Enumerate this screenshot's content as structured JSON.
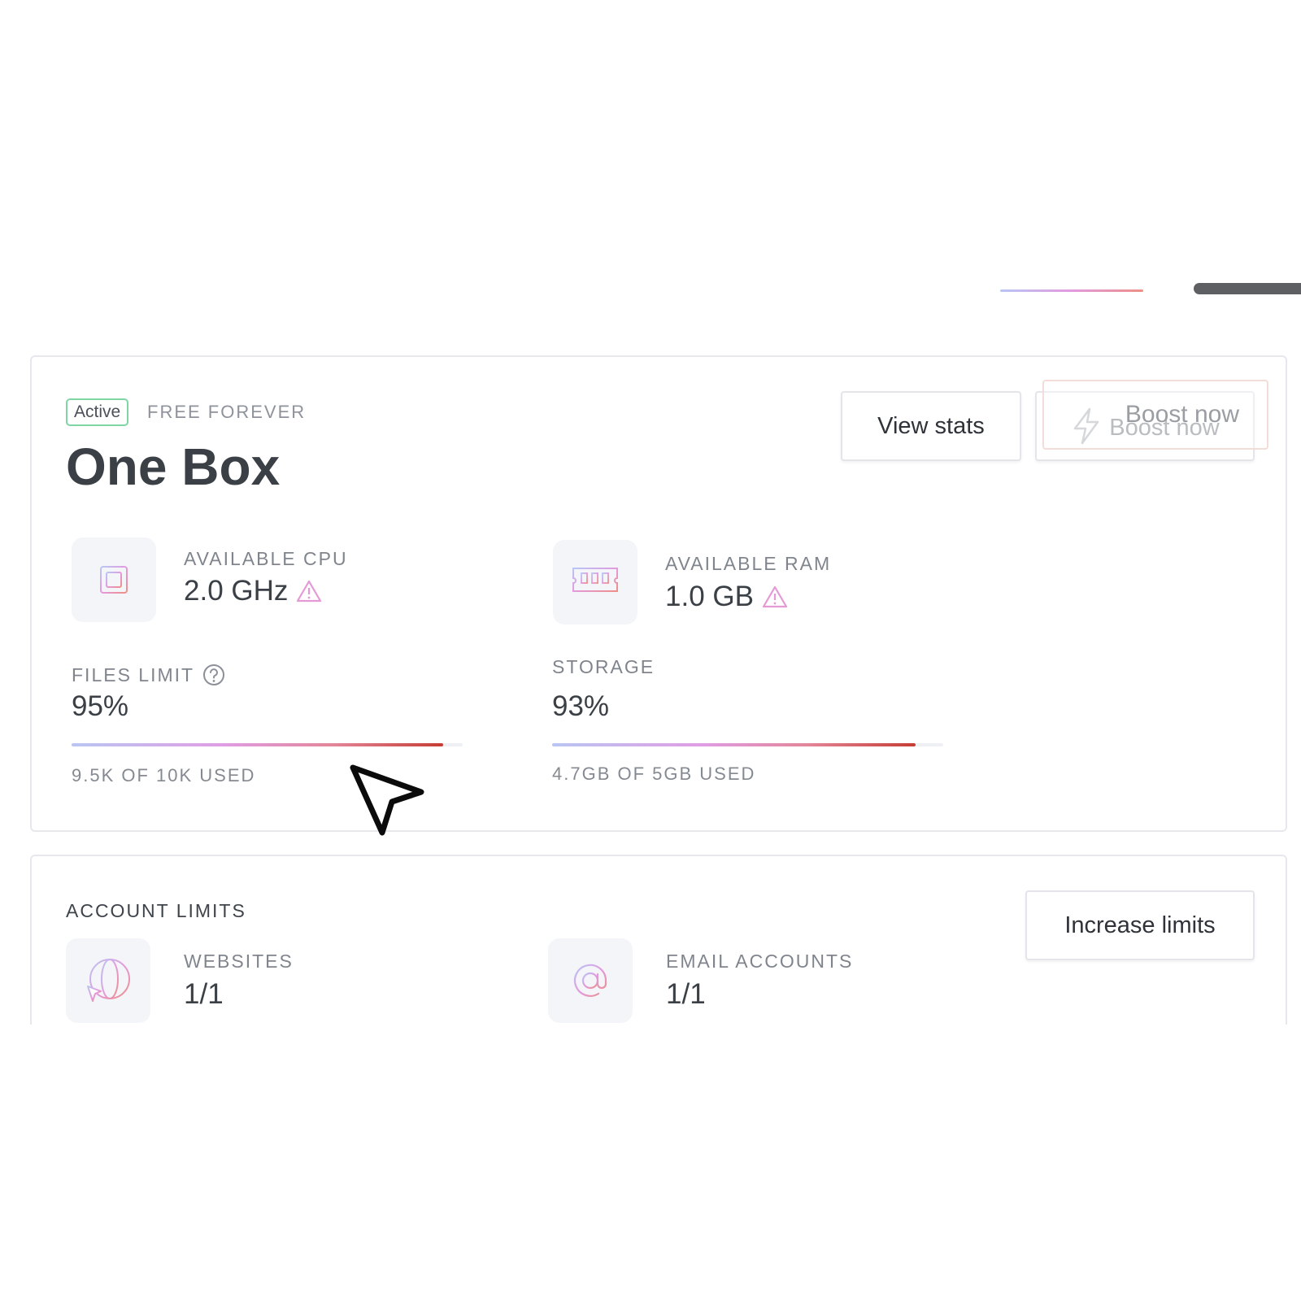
{
  "plan": {
    "status_badge": "Active",
    "plan_type": "FREE FOREVER",
    "title": "One Box",
    "view_stats_label": "View stats",
    "boost_label": "Boost now"
  },
  "resources": {
    "cpu": {
      "label": "AVAILABLE CPU",
      "value": "2.0 GHz",
      "icon": "cpu-chip-icon"
    },
    "ram": {
      "label": "AVAILABLE RAM",
      "value": "1.0 GB",
      "icon": "ram-module-icon"
    }
  },
  "meters": {
    "files": {
      "label": "FILES LIMIT",
      "value": "95%",
      "percent": 95,
      "footer": "9.5K OF 10K USED"
    },
    "storage": {
      "label": "STORAGE",
      "value": "93%",
      "percent": 93,
      "footer": "4.7GB OF 5GB USED"
    }
  },
  "account_limits": {
    "title": "ACCOUNT LIMITS",
    "increase_label": "Increase limits",
    "websites": {
      "label": "WEBSITES",
      "value": "1/1",
      "icon": "globe-cursor-icon"
    },
    "emails": {
      "label": "EMAIL ACCOUNTS",
      "value": "1/1",
      "icon": "at-sign-icon"
    }
  },
  "colors": {
    "active_border": "#7fd6a2",
    "meter_end": "#c63d34",
    "warning": "#e59ad6"
  }
}
